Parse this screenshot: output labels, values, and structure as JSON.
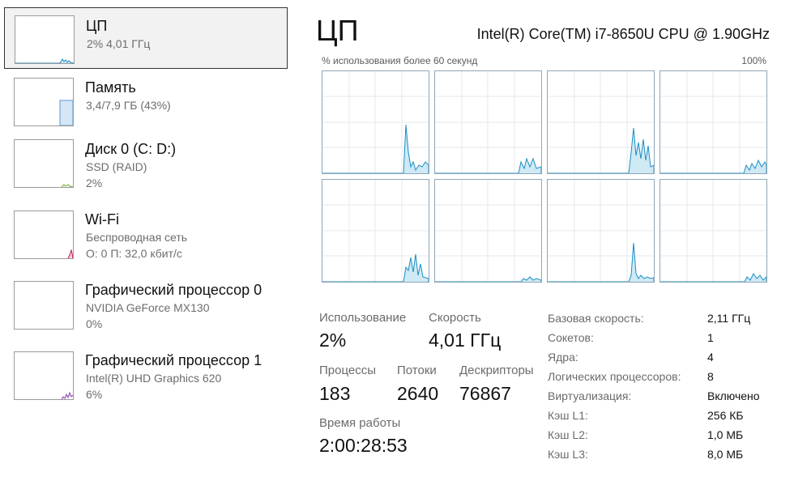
{
  "sidebar": {
    "items": [
      {
        "title": "ЦП",
        "sub1": "2% 4,01 ГГц",
        "sub2": "",
        "selected": true
      },
      {
        "title": "Память",
        "sub1": "3,4/7,9 ГБ (43%)",
        "sub2": ""
      },
      {
        "title": "Диск 0 (C: D:)",
        "sub1": "SSD (RAID)",
        "sub2": "2%"
      },
      {
        "title": "Wi-Fi",
        "sub1": "Беспроводная сеть",
        "sub2": "О: 0 П: 32,0 кбит/с"
      },
      {
        "title": "Графический процессор 0",
        "sub1": "NVIDIA GeForce MX130",
        "sub2": "0%"
      },
      {
        "title": "Графический процессор 1",
        "sub1": "Intel(R) UHD Graphics 620",
        "sub2": "6%"
      }
    ]
  },
  "main": {
    "title": "ЦП",
    "model": "Intel(R) Core(TM) i7-8650U CPU @ 1.90GHz",
    "graph_label": "% использования более 60 секунд",
    "graph_max": "100%",
    "stats": {
      "usage_label": "Использование",
      "usage_value": "2%",
      "speed_label": "Скорость",
      "speed_value": "4,01 ГГц",
      "processes_label": "Процессы",
      "processes_value": "183",
      "threads_label": "Потоки",
      "threads_value": "2640",
      "handles_label": "Дескрипторы",
      "handles_value": "76867",
      "uptime_label": "Время работы",
      "uptime_value": "2:00:28:53"
    },
    "properties": [
      {
        "label": "Базовая скорость:",
        "value": "2,11 ГГц"
      },
      {
        "label": "Сокетов:",
        "value": "1"
      },
      {
        "label": "Ядра:",
        "value": "4"
      },
      {
        "label": "Логических процессоров:",
        "value": "8"
      },
      {
        "label": "Виртуализация:",
        "value": "Включено"
      },
      {
        "label": "Кэш L1:",
        "value": "256 КБ"
      },
      {
        "label": "Кэш L2:",
        "value": "1,0 МБ"
      },
      {
        "label": "Кэш L3:",
        "value": "8,0 МБ"
      }
    ]
  },
  "colors": {
    "cpu_line": "#1a8fc4",
    "cpu_fill": "#cfe9f5",
    "memory": "#6fa8dc",
    "disk": "#7aa63a",
    "wifi": "#c2185b",
    "gpu": "#8e44ad"
  }
}
